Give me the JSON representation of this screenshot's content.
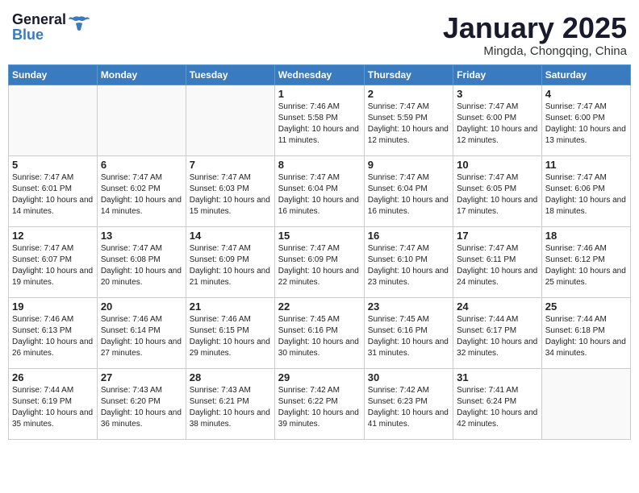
{
  "header": {
    "logo_general": "General",
    "logo_blue": "Blue",
    "month_title": "January 2025",
    "location": "Mingda, Chongqing, China"
  },
  "weekdays": [
    "Sunday",
    "Monday",
    "Tuesday",
    "Wednesday",
    "Thursday",
    "Friday",
    "Saturday"
  ],
  "weeks": [
    [
      {
        "day": "",
        "info": ""
      },
      {
        "day": "",
        "info": ""
      },
      {
        "day": "",
        "info": ""
      },
      {
        "day": "1",
        "info": "Sunrise: 7:46 AM\nSunset: 5:58 PM\nDaylight: 10 hours and 11 minutes."
      },
      {
        "day": "2",
        "info": "Sunrise: 7:47 AM\nSunset: 5:59 PM\nDaylight: 10 hours and 12 minutes."
      },
      {
        "day": "3",
        "info": "Sunrise: 7:47 AM\nSunset: 6:00 PM\nDaylight: 10 hours and 12 minutes."
      },
      {
        "day": "4",
        "info": "Sunrise: 7:47 AM\nSunset: 6:00 PM\nDaylight: 10 hours and 13 minutes."
      }
    ],
    [
      {
        "day": "5",
        "info": "Sunrise: 7:47 AM\nSunset: 6:01 PM\nDaylight: 10 hours and 14 minutes."
      },
      {
        "day": "6",
        "info": "Sunrise: 7:47 AM\nSunset: 6:02 PM\nDaylight: 10 hours and 14 minutes."
      },
      {
        "day": "7",
        "info": "Sunrise: 7:47 AM\nSunset: 6:03 PM\nDaylight: 10 hours and 15 minutes."
      },
      {
        "day": "8",
        "info": "Sunrise: 7:47 AM\nSunset: 6:04 PM\nDaylight: 10 hours and 16 minutes."
      },
      {
        "day": "9",
        "info": "Sunrise: 7:47 AM\nSunset: 6:04 PM\nDaylight: 10 hours and 16 minutes."
      },
      {
        "day": "10",
        "info": "Sunrise: 7:47 AM\nSunset: 6:05 PM\nDaylight: 10 hours and 17 minutes."
      },
      {
        "day": "11",
        "info": "Sunrise: 7:47 AM\nSunset: 6:06 PM\nDaylight: 10 hours and 18 minutes."
      }
    ],
    [
      {
        "day": "12",
        "info": "Sunrise: 7:47 AM\nSunset: 6:07 PM\nDaylight: 10 hours and 19 minutes."
      },
      {
        "day": "13",
        "info": "Sunrise: 7:47 AM\nSunset: 6:08 PM\nDaylight: 10 hours and 20 minutes."
      },
      {
        "day": "14",
        "info": "Sunrise: 7:47 AM\nSunset: 6:09 PM\nDaylight: 10 hours and 21 minutes."
      },
      {
        "day": "15",
        "info": "Sunrise: 7:47 AM\nSunset: 6:09 PM\nDaylight: 10 hours and 22 minutes."
      },
      {
        "day": "16",
        "info": "Sunrise: 7:47 AM\nSunset: 6:10 PM\nDaylight: 10 hours and 23 minutes."
      },
      {
        "day": "17",
        "info": "Sunrise: 7:47 AM\nSunset: 6:11 PM\nDaylight: 10 hours and 24 minutes."
      },
      {
        "day": "18",
        "info": "Sunrise: 7:46 AM\nSunset: 6:12 PM\nDaylight: 10 hours and 25 minutes."
      }
    ],
    [
      {
        "day": "19",
        "info": "Sunrise: 7:46 AM\nSunset: 6:13 PM\nDaylight: 10 hours and 26 minutes."
      },
      {
        "day": "20",
        "info": "Sunrise: 7:46 AM\nSunset: 6:14 PM\nDaylight: 10 hours and 27 minutes."
      },
      {
        "day": "21",
        "info": "Sunrise: 7:46 AM\nSunset: 6:15 PM\nDaylight: 10 hours and 29 minutes."
      },
      {
        "day": "22",
        "info": "Sunrise: 7:45 AM\nSunset: 6:16 PM\nDaylight: 10 hours and 30 minutes."
      },
      {
        "day": "23",
        "info": "Sunrise: 7:45 AM\nSunset: 6:16 PM\nDaylight: 10 hours and 31 minutes."
      },
      {
        "day": "24",
        "info": "Sunrise: 7:44 AM\nSunset: 6:17 PM\nDaylight: 10 hours and 32 minutes."
      },
      {
        "day": "25",
        "info": "Sunrise: 7:44 AM\nSunset: 6:18 PM\nDaylight: 10 hours and 34 minutes."
      }
    ],
    [
      {
        "day": "26",
        "info": "Sunrise: 7:44 AM\nSunset: 6:19 PM\nDaylight: 10 hours and 35 minutes."
      },
      {
        "day": "27",
        "info": "Sunrise: 7:43 AM\nSunset: 6:20 PM\nDaylight: 10 hours and 36 minutes."
      },
      {
        "day": "28",
        "info": "Sunrise: 7:43 AM\nSunset: 6:21 PM\nDaylight: 10 hours and 38 minutes."
      },
      {
        "day": "29",
        "info": "Sunrise: 7:42 AM\nSunset: 6:22 PM\nDaylight: 10 hours and 39 minutes."
      },
      {
        "day": "30",
        "info": "Sunrise: 7:42 AM\nSunset: 6:23 PM\nDaylight: 10 hours and 41 minutes."
      },
      {
        "day": "31",
        "info": "Sunrise: 7:41 AM\nSunset: 6:24 PM\nDaylight: 10 hours and 42 minutes."
      },
      {
        "day": "",
        "info": ""
      }
    ]
  ]
}
